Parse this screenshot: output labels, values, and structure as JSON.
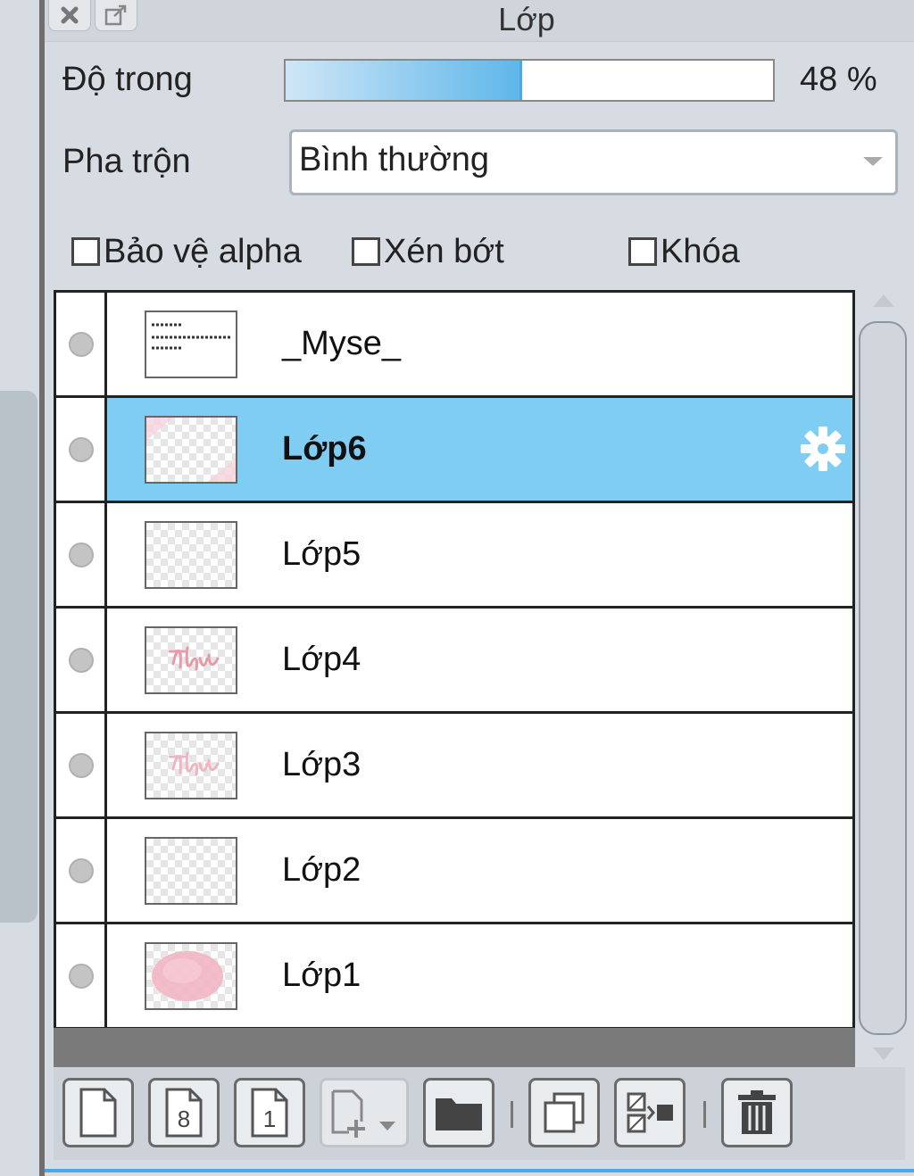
{
  "panel": {
    "title": "Lớp",
    "opacity_label": "Độ trong",
    "opacity_value": 48,
    "opacity_text": "48 %",
    "blend_label": "Pha trộn",
    "blend_value": "Bình thường",
    "options": {
      "protect_alpha": "Bảo vệ alpha",
      "clipping": "Xén bớt",
      "lock": "Khóa"
    }
  },
  "layers": [
    {
      "name": "_Myse_",
      "selected": false,
      "thumb": "text-thumbnail"
    },
    {
      "name": "Lớp6",
      "selected": true,
      "thumb": "pink-corner-thumbnail"
    },
    {
      "name": "Lớp5",
      "selected": false,
      "thumb": "empty-thumbnail"
    },
    {
      "name": "Lớp4",
      "selected": false,
      "thumb": "pink-script-thumbnail"
    },
    {
      "name": "Lớp3",
      "selected": false,
      "thumb": "pink-script-thumbnail"
    },
    {
      "name": "Lớp2",
      "selected": false,
      "thumb": "empty-thumbnail"
    },
    {
      "name": "Lớp1",
      "selected": false,
      "thumb": "pink-blob-thumbnail"
    }
  ],
  "toolbar": {
    "new_layer_icon": "page-icon",
    "new_8bit_icon": "page-8-icon",
    "new_1bit_icon": "page-1-icon",
    "add_menu_icon": "page-plus-dropdown-icon",
    "folder_icon": "folder-icon",
    "duplicate_icon": "duplicate-icon",
    "merge_icon": "merge-down-icon",
    "delete_icon": "trash-icon",
    "eight_label": "8",
    "one_label": "1"
  },
  "colors": {
    "selection": "#80cdf4",
    "opacity_fill": "#5fb7ea",
    "accent_line": "#4aa8e6"
  }
}
